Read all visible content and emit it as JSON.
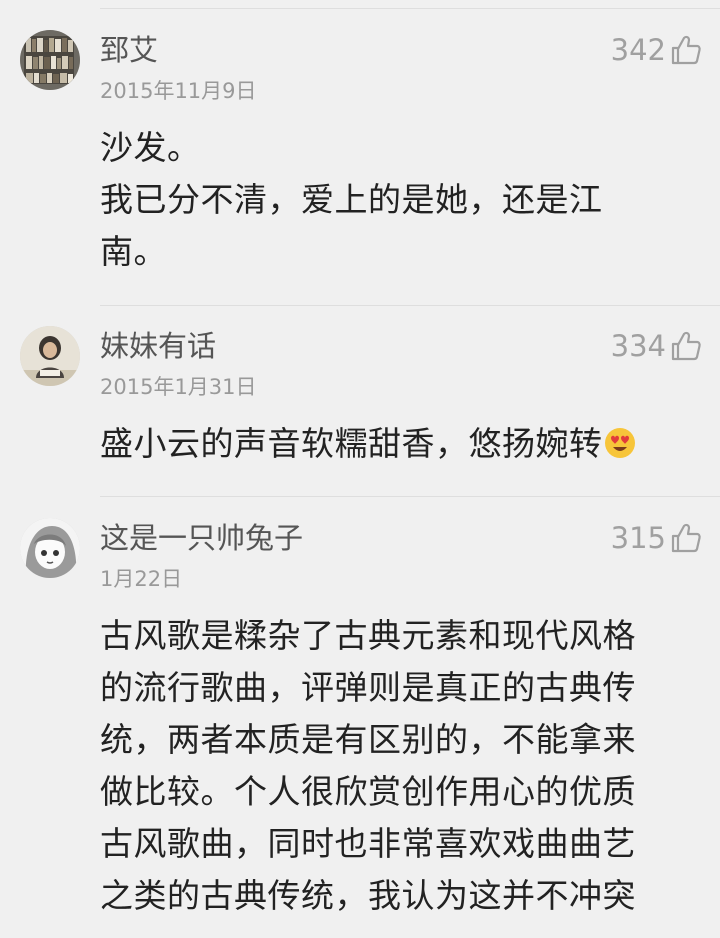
{
  "comments": [
    {
      "username": "郅艾",
      "date": "2015年11月9日",
      "likes": "342",
      "lines": [
        "沙发。",
        "我已分不清，爱上的是她，还是江",
        "南。"
      ]
    },
    {
      "username": "妹妹有话",
      "date": "2015年1月31日",
      "likes": "334",
      "lines": [
        "盛小云的声音软糯甜香，悠扬婉转"
      ]
    },
    {
      "username": "这是一只帅兔子",
      "date": "1月22日",
      "likes": "315",
      "lines": [
        "古风歌是糅杂了古典元素和现代风格",
        "的流行歌曲，评弹则是真正的古典传",
        "统，两者本质是有区别的，不能拿来",
        "做比较。个人很欣赏创作用心的优质",
        "古风歌曲，同时也非常喜欢戏曲曲艺",
        "之类的古典传统，我认为这并不冲突"
      ]
    }
  ],
  "icons": {
    "like": "thumbs-up-icon",
    "emoji": "heart-eyes-emoji-icon"
  }
}
